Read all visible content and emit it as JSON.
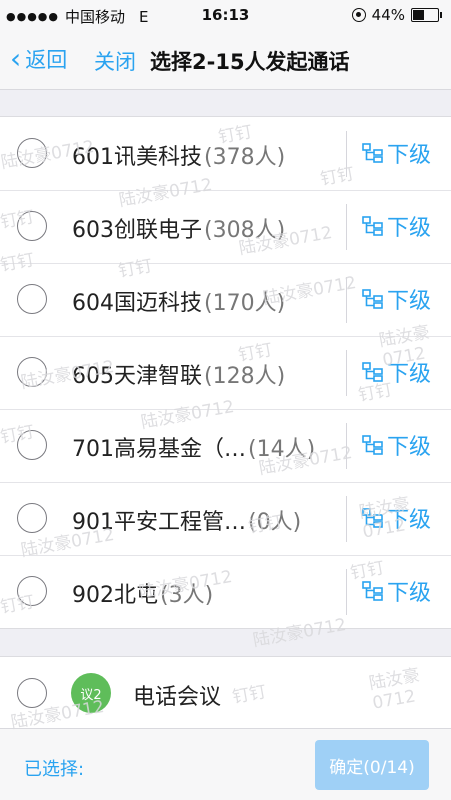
{
  "status_bar": {
    "carrier": "中国移动",
    "network": "E",
    "time": "16:13",
    "battery": "44%"
  },
  "nav": {
    "back_label": "返回",
    "close_label": "关闭",
    "title": "选择2-15人发起通话"
  },
  "departments": [
    {
      "name": "601讯美科技",
      "count": "(378人)",
      "sub_label": "下级"
    },
    {
      "name": "603创联电子",
      "count": "(308人)",
      "sub_label": "下级"
    },
    {
      "name": "604国迈科技",
      "count": "(170人)",
      "sub_label": "下级"
    },
    {
      "name": "605天津智联",
      "count": "(128人)",
      "sub_label": "下级"
    },
    {
      "name": "701高易基金（…",
      "count": "(14人)",
      "sub_label": "下级"
    },
    {
      "name": "901平安工程管…",
      "count": "(0人)",
      "sub_label": "下级"
    },
    {
      "name": "902北屯",
      "count": "(3人)",
      "sub_label": "下级"
    }
  ],
  "conference": {
    "badge": "议2",
    "name": "电话会议",
    "badge_color": "#5fbd5a"
  },
  "bottom": {
    "selected_label": "已选择:",
    "confirm_label": "确定(0/14)"
  },
  "watermark": {
    "name": "陆汝豪0712",
    "app": "钉钉"
  },
  "colors": {
    "accent": "#2aa3f0",
    "confirm_disabled": "#9fd0f6"
  }
}
